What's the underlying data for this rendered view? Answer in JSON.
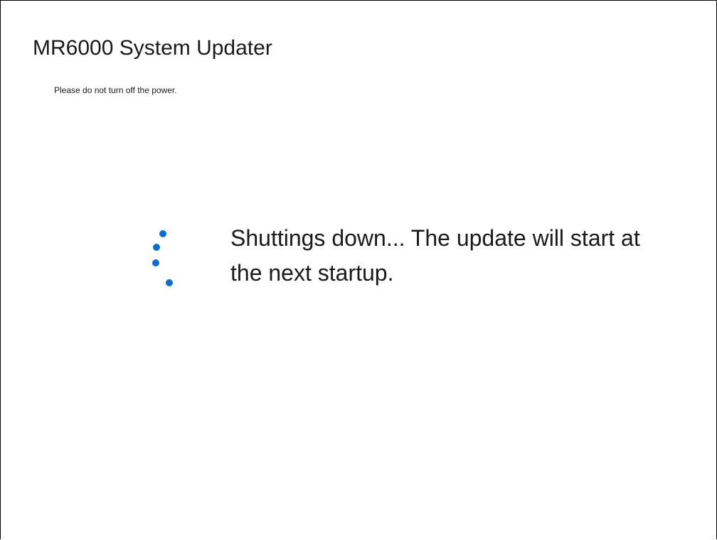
{
  "window": {
    "title": "MR6000 System Updater",
    "subtitle": "Please do not turn off the power."
  },
  "status": {
    "message": "Shuttings down...  The update will start at the next startup.",
    "spinner_icon": "loading-spinner-icon",
    "spinner_color": "#0a6fd4"
  }
}
